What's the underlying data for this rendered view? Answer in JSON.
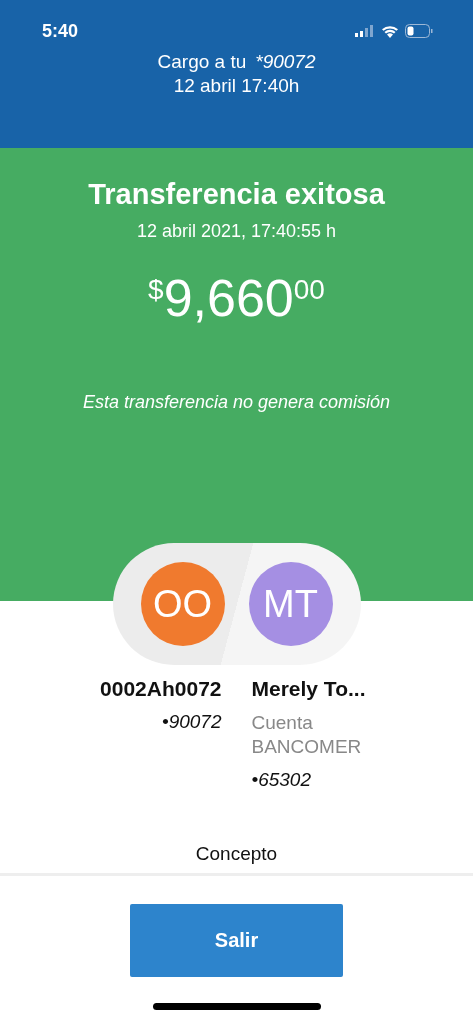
{
  "status_bar": {
    "time": "5:40"
  },
  "header": {
    "charge_label": "Cargo a tu",
    "account": "*90072",
    "date": "12 abril 17:40h"
  },
  "result": {
    "title": "Transferencia exitosa",
    "datetime": "12 abril 2021, 17:40:55 h",
    "amount": {
      "currency": "$",
      "whole": "9,660",
      "cents": "00"
    },
    "note": "Esta transferencia no genera comisión"
  },
  "parties": [
    {
      "initials": "OO",
      "color": "#f07a2e",
      "name": "0002Ah0072",
      "lines": [
        {
          "kind": "account",
          "text": "•90072"
        }
      ]
    },
    {
      "initials": "MT",
      "color": "#a58fe3",
      "name": "Merely To...",
      "lines": [
        {
          "kind": "bank",
          "text": "Cuenta BANCOMER"
        },
        {
          "kind": "account",
          "text": "•65302"
        }
      ]
    }
  ],
  "concept_label": "Concepto",
  "button": "Salir"
}
